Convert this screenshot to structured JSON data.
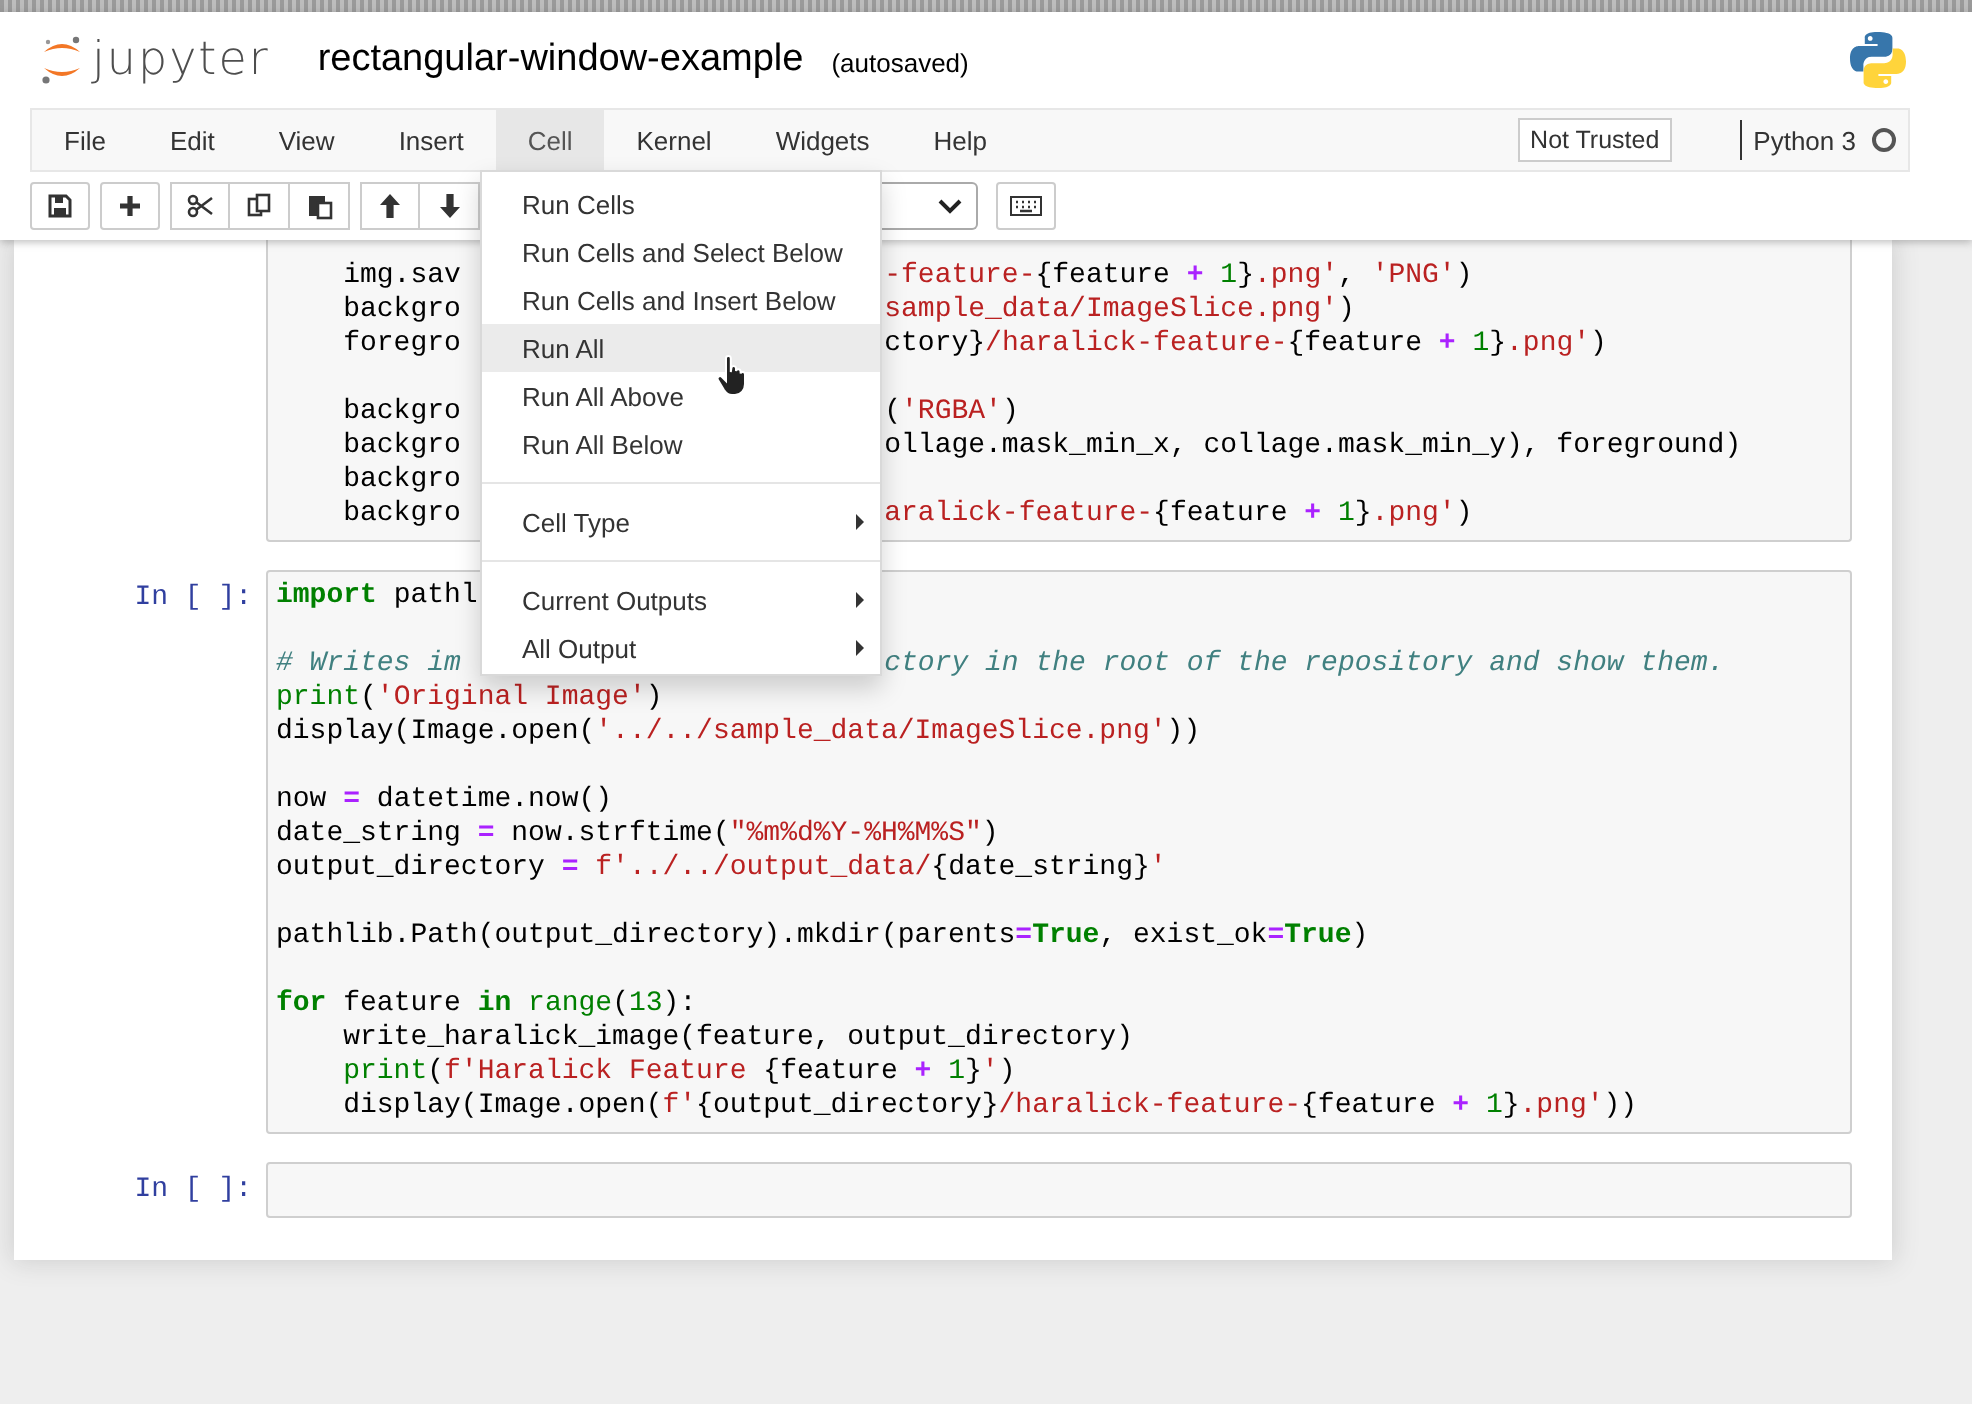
{
  "window": {
    "title": "rectangular-window-example",
    "save_status": "(autosaved)",
    "logo_text": "jupyter"
  },
  "menubar": {
    "items": [
      {
        "label": "File",
        "selected": false
      },
      {
        "label": "Edit",
        "selected": false
      },
      {
        "label": "View",
        "selected": false
      },
      {
        "label": "Insert",
        "selected": false
      },
      {
        "label": "Cell",
        "selected": true
      },
      {
        "label": "Kernel",
        "selected": false
      },
      {
        "label": "Widgets",
        "selected": false
      },
      {
        "label": "Help",
        "selected": false
      }
    ],
    "trust_button": "Not Trusted",
    "kernel_name": "Python 3",
    "kernel_busy": false
  },
  "cell_menu": {
    "items": [
      {
        "kind": "item",
        "label": "Run Cells",
        "selected": false
      },
      {
        "kind": "item",
        "label": "Run Cells and Select Below",
        "selected": false
      },
      {
        "kind": "item",
        "label": "Run Cells and Insert Below",
        "selected": false
      },
      {
        "kind": "item",
        "label": "Run All",
        "selected": true
      },
      {
        "kind": "item",
        "label": "Run All Above",
        "selected": false
      },
      {
        "kind": "item",
        "label": "Run All Below",
        "selected": false
      },
      {
        "kind": "divider"
      },
      {
        "kind": "submenu",
        "label": "Cell Type",
        "selected": false
      },
      {
        "kind": "divider"
      },
      {
        "kind": "submenu",
        "label": "Current Outputs",
        "selected": false
      },
      {
        "kind": "submenu",
        "label": "All Output",
        "selected": false
      }
    ]
  },
  "cells": [
    {
      "lines": [
        {
          "kind": "split",
          "left": [
            {
              "kind": "name",
              "text": "    img.sav"
            }
          ],
          "right": [
            {
              "kind": "string",
              "text": "-feature-"
            },
            {
              "kind": "name",
              "text": "{feature "
            },
            {
              "kind": "operator",
              "text": "+"
            },
            {
              "kind": "number",
              "text": " 1"
            },
            {
              "kind": "name",
              "text": "}"
            },
            {
              "kind": "string",
              "text": ".png'"
            },
            {
              "kind": "name",
              "text": ", "
            },
            {
              "kind": "string",
              "text": "'PNG'"
            },
            {
              "kind": "name",
              "text": ")"
            }
          ]
        },
        {
          "kind": "split",
          "left": [
            {
              "kind": "name",
              "text": "    backgro"
            }
          ],
          "right": [
            {
              "kind": "string",
              "text": "sample_data/ImageSlice.png'"
            },
            {
              "kind": "name",
              "text": ")"
            }
          ]
        },
        {
          "kind": "split",
          "left": [
            {
              "kind": "name",
              "text": "    foregro"
            }
          ],
          "right": [
            {
              "kind": "name",
              "text": "ctory}"
            },
            {
              "kind": "string",
              "text": "/haralick-feature-"
            },
            {
              "kind": "name",
              "text": "{feature "
            },
            {
              "kind": "operator",
              "text": "+"
            },
            {
              "kind": "number",
              "text": " 1"
            },
            {
              "kind": "name",
              "text": "}"
            },
            {
              "kind": "string",
              "text": ".png'"
            },
            {
              "kind": "name",
              "text": ")"
            }
          ]
        },
        {
          "kind": "blank"
        },
        {
          "kind": "split",
          "left": [
            {
              "kind": "name",
              "text": "    backgro"
            }
          ],
          "right": [
            {
              "kind": "name",
              "text": "("
            },
            {
              "kind": "string",
              "text": "'RGBA'"
            },
            {
              "kind": "name",
              "text": ")"
            }
          ]
        },
        {
          "kind": "split",
          "left": [
            {
              "kind": "name",
              "text": "    backgro"
            }
          ],
          "right": [
            {
              "kind": "name",
              "text": "ollage.mask_min_x, collage.mask_min_y), foreground)"
            }
          ]
        },
        {
          "kind": "code",
          "tokens": [
            {
              "kind": "name",
              "text": "    backgro"
            }
          ]
        },
        {
          "kind": "split",
          "left": [
            {
              "kind": "name",
              "text": "    backgro"
            }
          ],
          "right": [
            {
              "kind": "string",
              "text": "aralick-feature-"
            },
            {
              "kind": "name",
              "text": "{feature "
            },
            {
              "kind": "operator",
              "text": "+"
            },
            {
              "kind": "number",
              "text": " 1"
            },
            {
              "kind": "name",
              "text": "}"
            },
            {
              "kind": "string",
              "text": ".png'"
            },
            {
              "kind": "name",
              "text": ")"
            }
          ]
        }
      ]
    },
    {
      "prompt": "In [ ]:",
      "lines": [
        {
          "kind": "code",
          "tokens": [
            {
              "kind": "keyword",
              "text": "import"
            },
            {
              "kind": "name",
              "text": " pathl"
            }
          ]
        },
        {
          "kind": "blank"
        },
        {
          "kind": "split",
          "left": [
            {
              "kind": "comment",
              "text": "# Writes im"
            }
          ],
          "right": [
            {
              "kind": "comment",
              "text": "ctory in the root of the repository and show them."
            }
          ]
        },
        {
          "kind": "code",
          "tokens": [
            {
              "kind": "builtin",
              "text": "print"
            },
            {
              "kind": "name",
              "text": "("
            },
            {
              "kind": "string",
              "text": "'Original Image'"
            },
            {
              "kind": "name",
              "text": ")"
            }
          ]
        },
        {
          "kind": "code",
          "tokens": [
            {
              "kind": "name",
              "text": "display(Image.open("
            },
            {
              "kind": "string",
              "text": "'../../sample_data/ImageSlice.png'"
            },
            {
              "kind": "name",
              "text": "))"
            }
          ]
        },
        {
          "kind": "blank"
        },
        {
          "kind": "code",
          "tokens": [
            {
              "kind": "name",
              "text": "now "
            },
            {
              "kind": "operator",
              "text": "="
            },
            {
              "kind": "name",
              "text": " datetime.now()"
            }
          ]
        },
        {
          "kind": "code",
          "tokens": [
            {
              "kind": "name",
              "text": "date_string "
            },
            {
              "kind": "operator",
              "text": "="
            },
            {
              "kind": "name",
              "text": " now.strftime("
            },
            {
              "kind": "string",
              "text": "\"%m%d%Y-%H%M%S\""
            },
            {
              "kind": "name",
              "text": ")"
            }
          ]
        },
        {
          "kind": "code",
          "tokens": [
            {
              "kind": "name",
              "text": "output_directory "
            },
            {
              "kind": "operator",
              "text": "="
            },
            {
              "kind": "string",
              "text": " f'../../output_data/"
            },
            {
              "kind": "name",
              "text": "{date_string}"
            },
            {
              "kind": "string",
              "text": "'"
            }
          ]
        },
        {
          "kind": "blank"
        },
        {
          "kind": "code",
          "tokens": [
            {
              "kind": "name",
              "text": "pathlib.Path(output_directory).mkdir(parents"
            },
            {
              "kind": "operator",
              "text": "="
            },
            {
              "kind": "keyword",
              "text": "True"
            },
            {
              "kind": "name",
              "text": ", exist_ok"
            },
            {
              "kind": "operator",
              "text": "="
            },
            {
              "kind": "keyword",
              "text": "True"
            },
            {
              "kind": "name",
              "text": ")"
            }
          ]
        },
        {
          "kind": "blank"
        },
        {
          "kind": "code",
          "tokens": [
            {
              "kind": "keyword",
              "text": "for"
            },
            {
              "kind": "name",
              "text": " feature "
            },
            {
              "kind": "keyword",
              "text": "in"
            },
            {
              "kind": "builtin",
              "text": " range"
            },
            {
              "kind": "name",
              "text": "("
            },
            {
              "kind": "number",
              "text": "13"
            },
            {
              "kind": "name",
              "text": "):"
            }
          ]
        },
        {
          "kind": "code",
          "tokens": [
            {
              "kind": "name",
              "text": "    write_haralick_image(feature, output_directory)"
            }
          ]
        },
        {
          "kind": "code",
          "tokens": [
            {
              "kind": "builtin",
              "text": "    print"
            },
            {
              "kind": "name",
              "text": "("
            },
            {
              "kind": "string",
              "text": "f'Haralick Feature "
            },
            {
              "kind": "name",
              "text": "{feature "
            },
            {
              "kind": "operator",
              "text": "+"
            },
            {
              "kind": "number",
              "text": " 1"
            },
            {
              "kind": "name",
              "text": "}"
            },
            {
              "kind": "string",
              "text": "'"
            },
            {
              "kind": "name",
              "text": ")"
            }
          ]
        },
        {
          "kind": "code",
          "tokens": [
            {
              "kind": "name",
              "text": "    display(Image.open("
            },
            {
              "kind": "string",
              "text": "f'"
            },
            {
              "kind": "name",
              "text": "{output_directory}"
            },
            {
              "kind": "string",
              "text": "/haralick-feature-"
            },
            {
              "kind": "name",
              "text": "{feature "
            },
            {
              "kind": "operator",
              "text": "+"
            },
            {
              "kind": "number",
              "text": " 1"
            },
            {
              "kind": "name",
              "text": "}"
            },
            {
              "kind": "string",
              "text": ".png'"
            },
            {
              "kind": "name",
              "text": "))"
            }
          ]
        }
      ]
    },
    {
      "prompt": "In [ ]:"
    }
  ]
}
